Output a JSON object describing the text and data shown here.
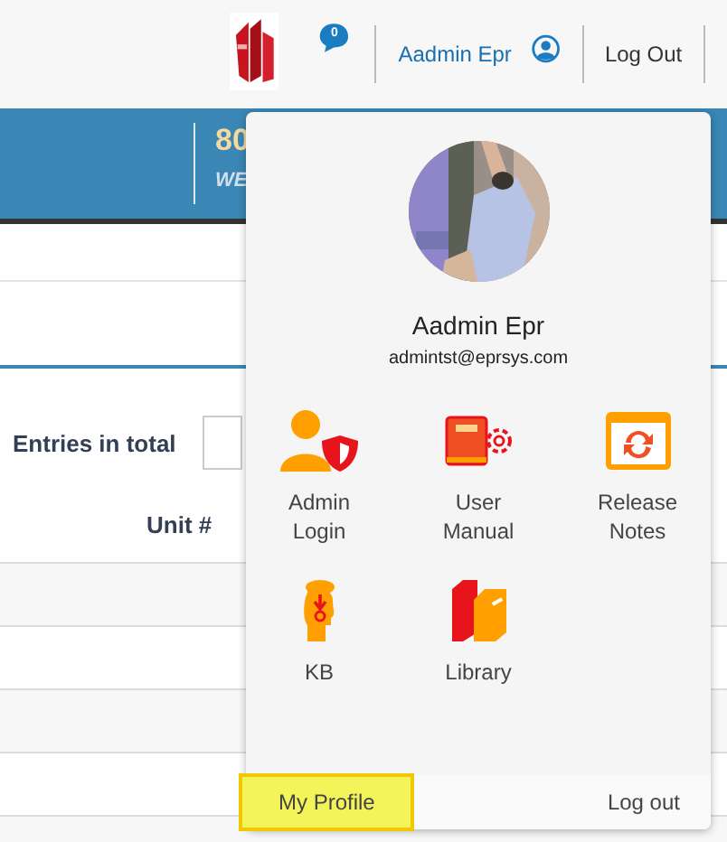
{
  "header": {
    "notification_count": "0",
    "user_name": "Aadmin Epr",
    "logout": "Log Out"
  },
  "banner": {
    "stat_value": "80",
    "stat_label": "WE"
  },
  "list": {
    "summary": "Entries in total",
    "columns": [
      "Unit #"
    ]
  },
  "dropdown": {
    "name": "Aadmin Epr",
    "email": "admintst@eprsys.com",
    "items": [
      {
        "kind": "admin",
        "label": "Admin Login"
      },
      {
        "kind": "manual",
        "label": "User Manual"
      },
      {
        "kind": "release",
        "label": "Release Notes"
      },
      {
        "kind": "kb",
        "label": "KB"
      },
      {
        "kind": "library",
        "label": "Library"
      }
    ],
    "footer": [
      {
        "label": "My Profile",
        "highlighted": true
      },
      {
        "label": "Log out",
        "highlighted": false
      }
    ]
  }
}
